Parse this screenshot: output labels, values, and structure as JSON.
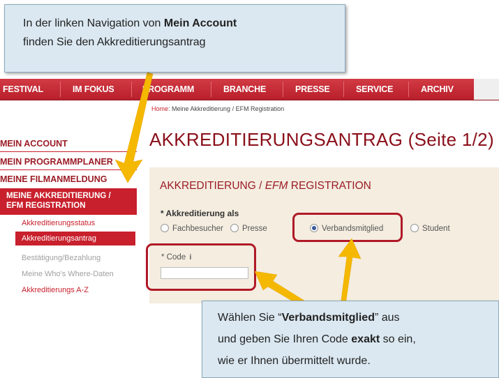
{
  "nav": {
    "items": [
      "FESTIVAL",
      "IM FOKUS",
      "PROGRAMM",
      "BRANCHE",
      "PRESSE",
      "SERVICE",
      "ARCHIV"
    ]
  },
  "breadcrumb": {
    "home": "Home",
    "rest": ": Meine Akkreditierung / EFM Registration"
  },
  "sidebar": {
    "main_items": [
      "MEIN ACCOUNT",
      "MEIN PROGRAMMPLANER",
      "MEINE FILMANMELDUNG"
    ],
    "active_line1": "MEINE AKKREDITIERUNG /",
    "active_line2": "EFM REGISTRATION",
    "sub_items": [
      "Akkreditierungsstatus",
      "Akkreditierungsantrag",
      "Bestätigung/Bezahlung",
      "Meine Who's Where-Daten",
      "Akkreditierungs A-Z"
    ]
  },
  "page_title": "AKKREDITIERUNGSANTRAG (Seite 1/2)",
  "form": {
    "heading_part1": "AKKREDITIERUNG / ",
    "heading_part2": "EFM",
    "heading_part3": " REGISTRATION",
    "accreditation_label": "* Akkreditierung als",
    "options": [
      "Fachbesucher",
      "Presse",
      "Verbandsmitglied",
      "Student"
    ],
    "selected_option": "Verbandsmitglied",
    "code_label": "* Code",
    "info_icon": "i",
    "code_value": ""
  },
  "callout_top": {
    "text1": "In der linken Navigation von ",
    "bold": "Mein Account",
    "text2": "finden Sie den Akkreditierungsantrag"
  },
  "callout_bottom": {
    "text1": "Wählen Sie “",
    "bold1": "Verbandsmitglied",
    "text2": "” aus",
    "text3": "und geben Sie Ihren Code ",
    "bold2": "exakt",
    "text4": " so ein,",
    "text5": "wie er Ihnen übermittelt wurde."
  },
  "colors": {
    "brand_red": "#c8202c",
    "callout_bg": "#dbe8f1",
    "arrow": "#f5b800",
    "panel_bg": "#f4ede0"
  }
}
